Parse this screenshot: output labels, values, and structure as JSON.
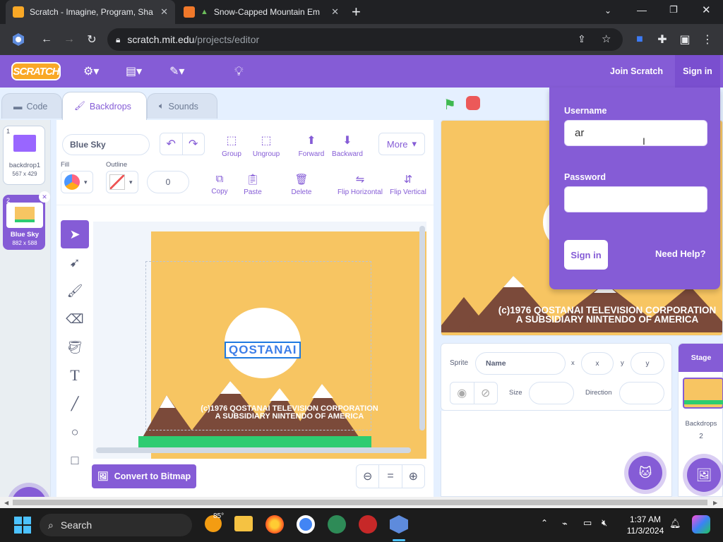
{
  "browser": {
    "tabs": [
      {
        "title": "Scratch - Imagine, Program, Sha",
        "close": "✕"
      },
      {
        "title": "Snow-Capped Mountain Em",
        "close": "✕"
      }
    ],
    "new_tab": "+",
    "url_host": "scratch.mit.edu",
    "url_path": "/projects/editor"
  },
  "menubar": {
    "logo": "SCRATCH",
    "join": "Join Scratch",
    "sign_in": "Sign in"
  },
  "editor_tabs": {
    "code": "Code",
    "backdrops": "Backdrops",
    "sounds": "Sounds"
  },
  "costumes": [
    {
      "index": "1",
      "name": "backdrop1",
      "size": "567 x 429"
    },
    {
      "index": "2",
      "name": "Blue Sky",
      "size": "882 x 588"
    }
  ],
  "paint": {
    "costume_name": "Blue Sky",
    "fill_label": "Fill",
    "outline_label": "Outline",
    "outline_width": "0",
    "more_label": "More",
    "actions_top": [
      "Group",
      "Ungroup",
      "Forward",
      "Backward"
    ],
    "actions_bottom": [
      "Copy",
      "Paste",
      "Delete",
      "Flip Horizontal",
      "Flip Vertical"
    ],
    "convert": "Convert to Bitmap",
    "zoom_reset": "="
  },
  "canvas": {
    "logo_text": "QOSTANAI",
    "caption_1": "(c)1976 QOSTANAI TELEVISION CORPORATION",
    "caption_2": "A SUBSIDIARY NINTENDO OF AMERICA"
  },
  "stage": {
    "caption_1": "(c)1976 QOSTANAI TELEVISION CORPORATION",
    "caption_2": "A SUBSIDIARY NINTENDO OF AMERICA"
  },
  "sprite_info": {
    "sprite_label": "Sprite",
    "name_placeholder": "Name",
    "x_label": "x",
    "x_placeholder": "x",
    "y_label": "y",
    "y_placeholder": "y",
    "size_label": "Size",
    "direction_label": "Direction"
  },
  "stage_panel": {
    "title": "Stage",
    "backdrops_label": "Backdrops",
    "backdrops_count": "2"
  },
  "signin": {
    "username_label": "Username",
    "username_value": "ar",
    "password_label": "Password",
    "button": "Sign in",
    "help": "Need Help?"
  },
  "taskbar": {
    "search": "Search",
    "weather": "85°",
    "time": "1:37 AM",
    "date": "11/3/2024"
  },
  "colors": {
    "accent": "#855cd6",
    "canvas": "#f7c562",
    "mountain": "#7b4a3a",
    "grass": "#2ecc71"
  }
}
